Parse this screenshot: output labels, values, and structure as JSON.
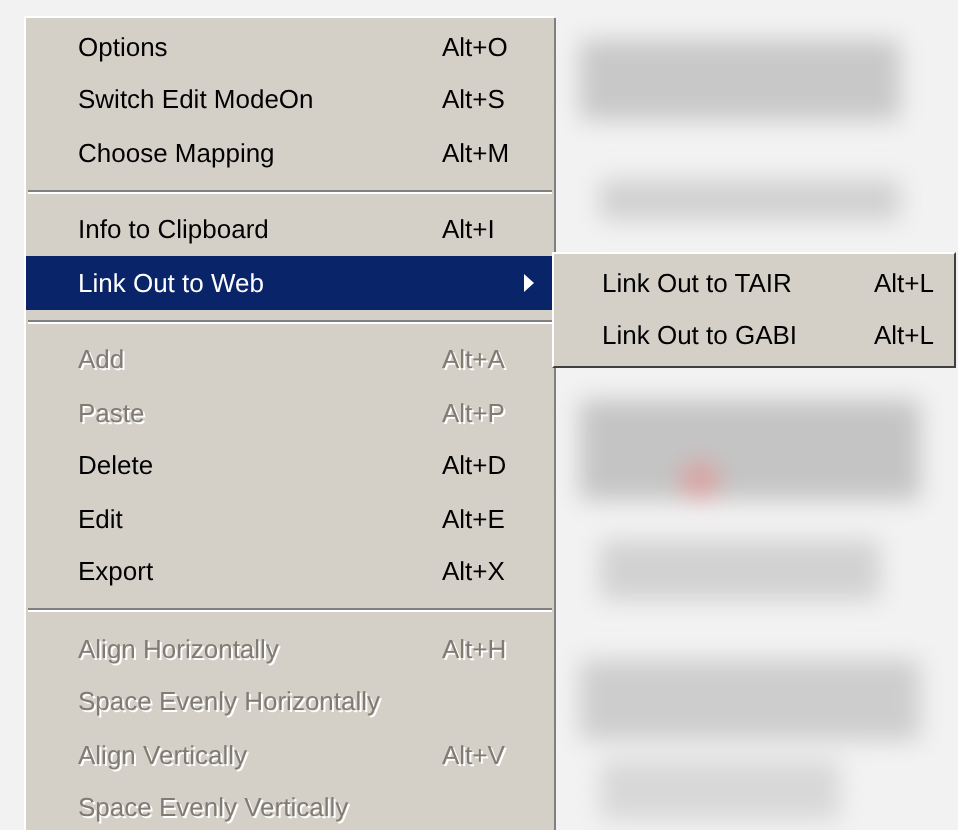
{
  "menu": {
    "groups": [
      [
        {
          "label": "Options",
          "shortcut": "Alt+O",
          "disabled": false,
          "selected": false,
          "submenu": false
        },
        {
          "label": "Switch Edit ModeOn",
          "shortcut": "Alt+S",
          "disabled": false,
          "selected": false,
          "submenu": false
        },
        {
          "label": "Choose Mapping",
          "shortcut": "Alt+M",
          "disabled": false,
          "selected": false,
          "submenu": false
        }
      ],
      [
        {
          "label": "Info to Clipboard",
          "shortcut": "Alt+I",
          "disabled": false,
          "selected": false,
          "submenu": false
        },
        {
          "label": "Link Out to Web",
          "disabled": false,
          "selected": true,
          "submenu": true
        }
      ],
      [
        {
          "label": "Add",
          "shortcut": "Alt+A",
          "disabled": true,
          "selected": false,
          "submenu": false
        },
        {
          "label": "Paste",
          "shortcut": "Alt+P",
          "disabled": true,
          "selected": false,
          "submenu": false
        },
        {
          "label": "Delete",
          "shortcut": "Alt+D",
          "disabled": false,
          "selected": false,
          "submenu": false
        },
        {
          "label": "Edit",
          "shortcut": "Alt+E",
          "disabled": false,
          "selected": false,
          "submenu": false
        },
        {
          "label": "Export",
          "shortcut": "Alt+X",
          "disabled": false,
          "selected": false,
          "submenu": false
        }
      ],
      [
        {
          "label": "Align Horizontally",
          "shortcut": "Alt+H",
          "disabled": true,
          "selected": false,
          "submenu": false
        },
        {
          "label": "Space Evenly Horizontally",
          "disabled": true,
          "selected": false,
          "submenu": false
        },
        {
          "label": "Align Vertically",
          "shortcut": "Alt+V",
          "disabled": true,
          "selected": false,
          "submenu": false
        },
        {
          "label": "Space Evenly Vertically",
          "disabled": true,
          "selected": false,
          "submenu": false
        }
      ]
    ]
  },
  "submenu": {
    "items": [
      {
        "label": "Link Out to TAIR",
        "shortcut": "Alt+L"
      },
      {
        "label": "Link Out to GABI",
        "shortcut": "Alt+L"
      }
    ]
  }
}
